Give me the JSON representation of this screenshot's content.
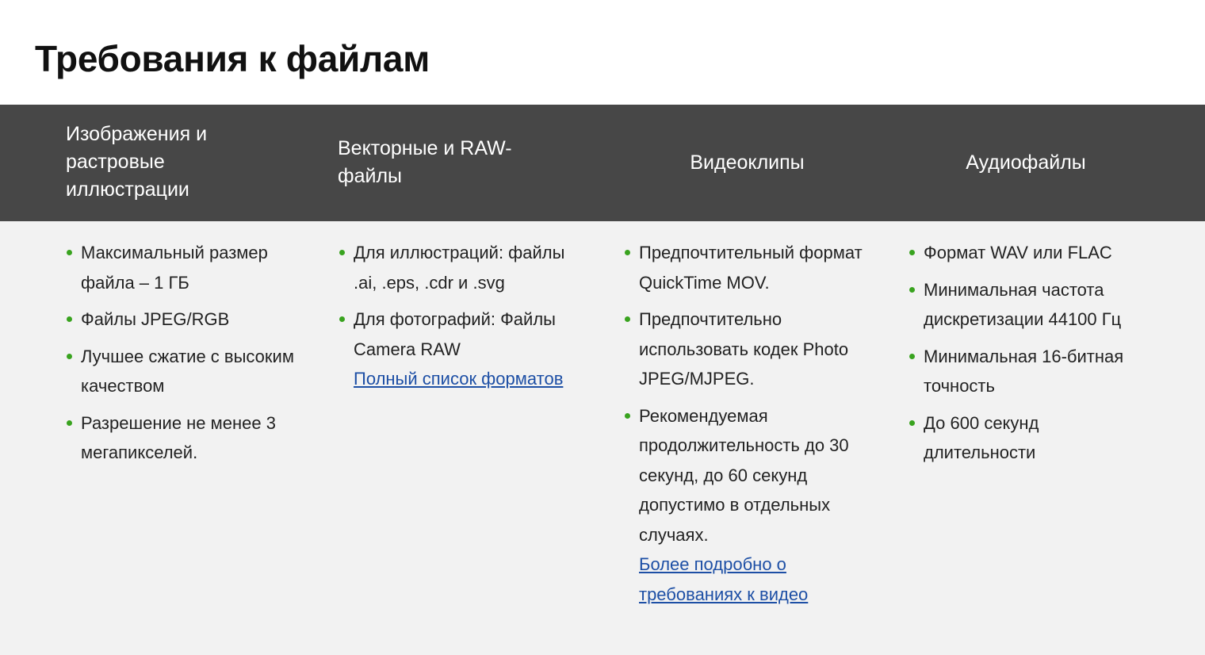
{
  "page": {
    "title": "Требования к файлам"
  },
  "columns": [
    {
      "header": "Изображения и растровые иллюстрации",
      "items": [
        "Максимальный размер файла – 1 ГБ",
        "Файлы JPEG/RGB",
        "Лучшее сжатие с высоким качеством",
        "Разрешение не менее 3 мегапикселей."
      ],
      "link": ""
    },
    {
      "header": "Векторные и RAW-файлы",
      "items": [
        "Для иллюстраций: файлы .ai, .eps, .cdr и .svg",
        "Для фотографий: Файлы Camera RAW"
      ],
      "link": "Полный список форматов"
    },
    {
      "header": "Видеоклипы",
      "items": [
        "Предпочтительный формат QuickTime MOV.",
        "Предпочтительно использовать кодек Photo JPEG/MJPEG.",
        "Рекомендуемая продолжительность до 30 секунд, до 60 секунд допустимо в отдельных случаях."
      ],
      "link": "Более подробно о требованиях к видео"
    },
    {
      "header": "Аудиофайлы",
      "items": [
        "Формат WAV или FLAC",
        "Минимальная частота дискретизации 44100 Гц",
        "Минимальная 16-битная точность",
        "До 600 секунд длительности"
      ],
      "link": ""
    }
  ],
  "colors": {
    "header_background": "#474747",
    "body_background": "#f2f2f2",
    "bullet": "#39a31f",
    "link": "#1d4fa5"
  }
}
